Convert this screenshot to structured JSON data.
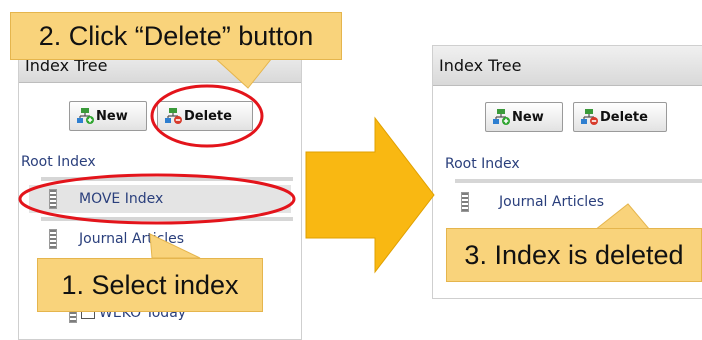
{
  "before": {
    "panel_title": "Index Tree",
    "new_button": "New",
    "delete_button": "Delete",
    "root_label": "Root Index",
    "items": [
      "MOVE Index",
      "Journal Articles",
      "WEKO Today"
    ]
  },
  "after": {
    "panel_title": "Index Tree",
    "new_button": "New",
    "delete_button": "Delete",
    "root_label": "Root Index",
    "items": [
      "Journal Articles"
    ]
  },
  "callouts": {
    "step1": "1. Select index",
    "step2": "2. Click “Delete” button",
    "step3": "3. Index is deleted"
  },
  "colors": {
    "callout_fill": "#f9d37b",
    "highlight_ring": "#e3141b",
    "arrow": "#f9b812",
    "link_text": "#2a3f7c"
  }
}
